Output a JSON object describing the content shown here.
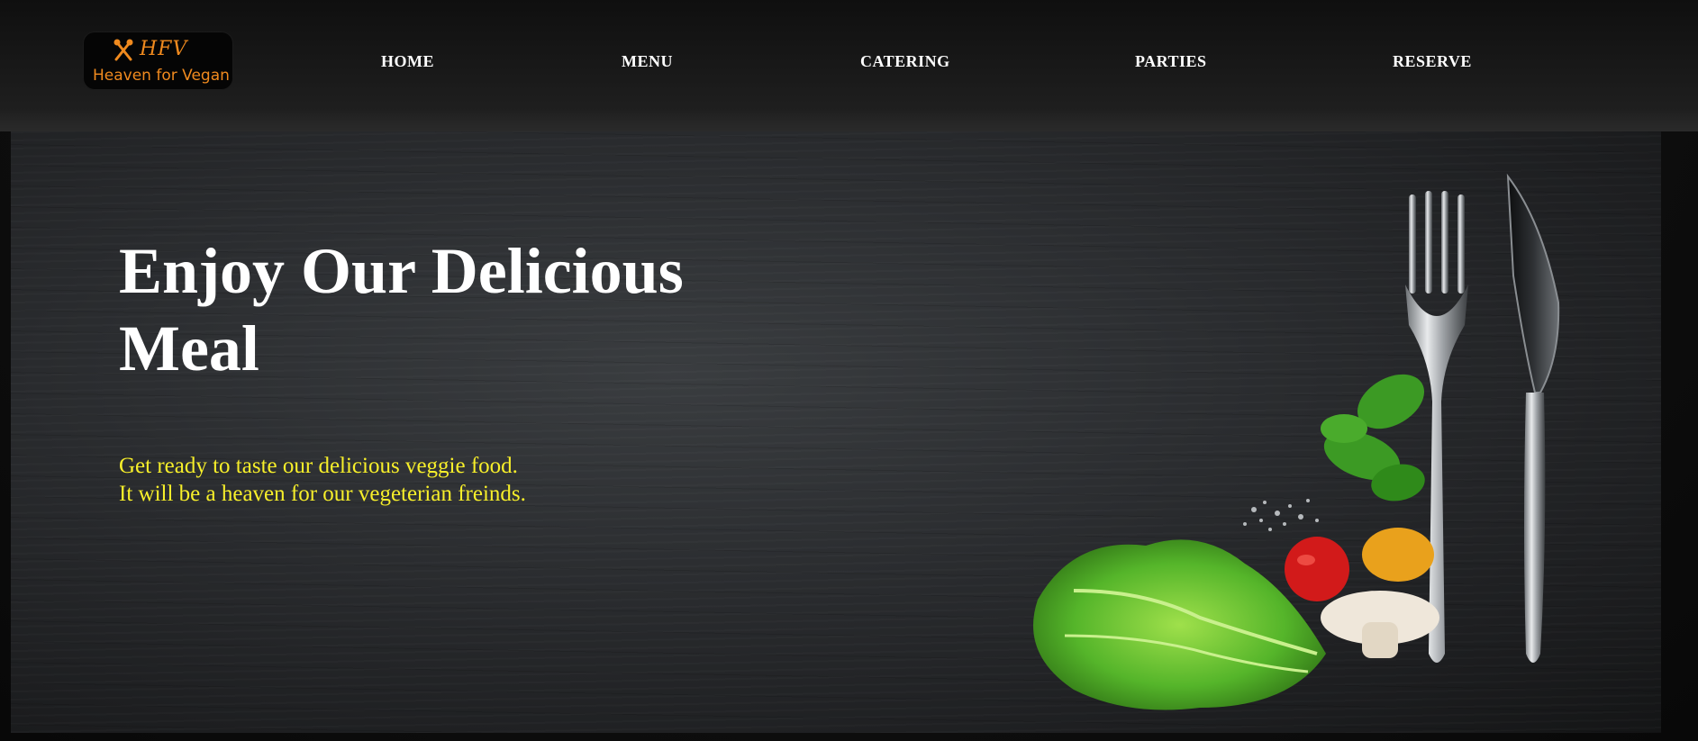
{
  "header": {
    "logo": {
      "abbr": "HFV",
      "name": "Heaven for Vegan"
    },
    "nav": [
      {
        "label": "HOME"
      },
      {
        "label": "MENU"
      },
      {
        "label": "CATERING"
      },
      {
        "label": "PARTIES"
      },
      {
        "label": "RESERVE"
      }
    ]
  },
  "hero": {
    "title": "Enjoy Our Delicious Meal",
    "subtitle_lines": [
      "Get ready to taste our delicious veggie food.",
      "It will be a heaven for our vegeterian freinds."
    ]
  },
  "colors": {
    "brand_orange": "#f08a1e",
    "subtitle_yellow": "#f7ef2a",
    "nav_text": "#ffffff"
  },
  "icons": [
    "fork-knife-icon"
  ]
}
